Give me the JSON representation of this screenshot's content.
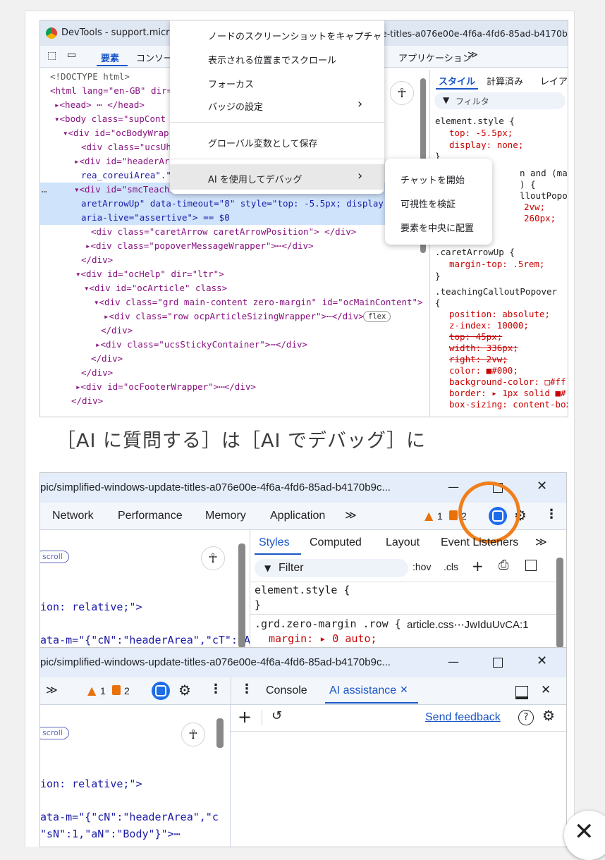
{
  "shot1": {
    "window_title": "DevTools - support.micro",
    "window_title_tail": "e-titles-a076e00e-4f6a-4fd6-85ad-b4170b",
    "tabs": {
      "elements": "要素",
      "console": "コンソー",
      "application": "アプリケーション",
      "more": "≫"
    },
    "dom_lines": [
      "<!DOCTYPE html>",
      "<html lang=\"en-GB\" dir=\"",
      "▸<head> ⋯ </head>",
      "▾<body class=\"supCont",
      "▾<div id=\"ocBodyWrap",
      "<div class=\"ucsUhf",
      "▸<div id=\"headerAre",
      "rea_coreuiArea\".\"",
      "▾<div id=\"smcTeachi",
      "aretArrowUp\" data-timeout=\"8\" style=\"top: -5.5px; display: no",
      "aria-live=\"assertive\"> == $0",
      "<div class=\"caretArrow caretArrowPosition\"> </div>",
      "▸<div class=\"popoverMessageWrapper\">⋯</div>",
      "</div>",
      "▾<div id=\"ocHelp\" dir=\"ltr\">",
      "▾<div id=\"ocArticle\" class>",
      "▾<div class=\"grd main-content zero-margin\" id=\"ocMainContent\">",
      "▸<div class=\"row ocpArticleSizingWrapper\">⋯</div>",
      "</div>",
      "▸<div class=\"ucsStickyContainer\">⋯</div>",
      "</div>",
      "</div>",
      "▸<div id=\"ocFooterWrapper\">⋯</div>",
      "</div>"
    ],
    "flex_badge": "flex",
    "ellipsis": "⋯",
    "style_tabs": {
      "styles": "スタイル",
      "computed": "計算済み",
      "layout": "レイア"
    },
    "filter_placeholder": "フィルタ",
    "style_lines": [
      "element.style {",
      "top: -5.5px;",
      "display: none;",
      "}",
      "n and (max-",
      ") {",
      "lloutPopover {",
      "2vw;",
      "260px;",
      ".caretArrowUp {",
      "margin-top: .5rem;",
      "}",
      ".teachingCalloutPopover",
      "{",
      "position: absolute;",
      "z-index: 10000;",
      "top: 45px;",
      "width: 336px;",
      "right: 2vw;",
      "color: ■#000;",
      "background-color: □#ff",
      "border: ▸ 1px solid ■#",
      "box-sizing: content-box;"
    ],
    "context_menu": [
      "ノードのスクリーンショットをキャプチャ",
      "表示される位置までスクロール",
      "フォーカス",
      "バッジの設定",
      "グローバル変数として保存",
      "AI を使用してデバッグ"
    ],
    "submenu": [
      "チャットを開始",
      "可視性を検証",
      "要素を中央に配置"
    ],
    "arrow": "›"
  },
  "caption": "［AI に質問する］は［AI でデバッグ］に",
  "shot2": {
    "url": "pic/simplified-windows-update-titles-a076e00e-4f6a-4fd6-85ad-b4170b9c...",
    "tabs": [
      "Network",
      "Performance",
      "Memory",
      "Application",
      "≫"
    ],
    "warn_count": "1",
    "issue_count": "2",
    "style_tabs": [
      "Styles",
      "Computed",
      "Layout",
      "Event Listeners",
      "≫"
    ],
    "filter_placeholder": "Filter",
    "hov": ":hov",
    "cls": ".cls",
    "scroll_badge": "scroll",
    "code_lines": [
      "ion: relative;\">",
      "ata-m=\"{\"cN\":\"headerArea\",\"cT\":\"A"
    ],
    "style_lines": [
      "element.style {",
      "}",
      ".grd.zero-margin .row {",
      "article.css⋯JwIduUvCA:1",
      "margin: ▸ 0 auto;"
    ],
    "win_min": "—",
    "win_close": "✕"
  },
  "shot3": {
    "url": "pic/simplified-windows-update-titles-a076e00e-4f6a-4fd6-85ad-b4170b9c...",
    "warn_count": "1",
    "issue_count": "2",
    "drawer_tabs": [
      "Console",
      "AI assistance"
    ],
    "send_feedback": "Send feedback",
    "scroll_badge": "scroll",
    "code_lines": [
      "ion: relative;\">",
      "ata-m=\"{\"cN\":\"headerArea\",\"c",
      "\"sN\":1,\"aN\":\"Body\"}\">⋯"
    ],
    "plus": "+",
    "win_min": "—",
    "win_close": "✕"
  },
  "colors": {
    "accent": "#1a56c7",
    "highlight_ring": "#f07f1b",
    "selected_row": "#cfe3fb"
  }
}
